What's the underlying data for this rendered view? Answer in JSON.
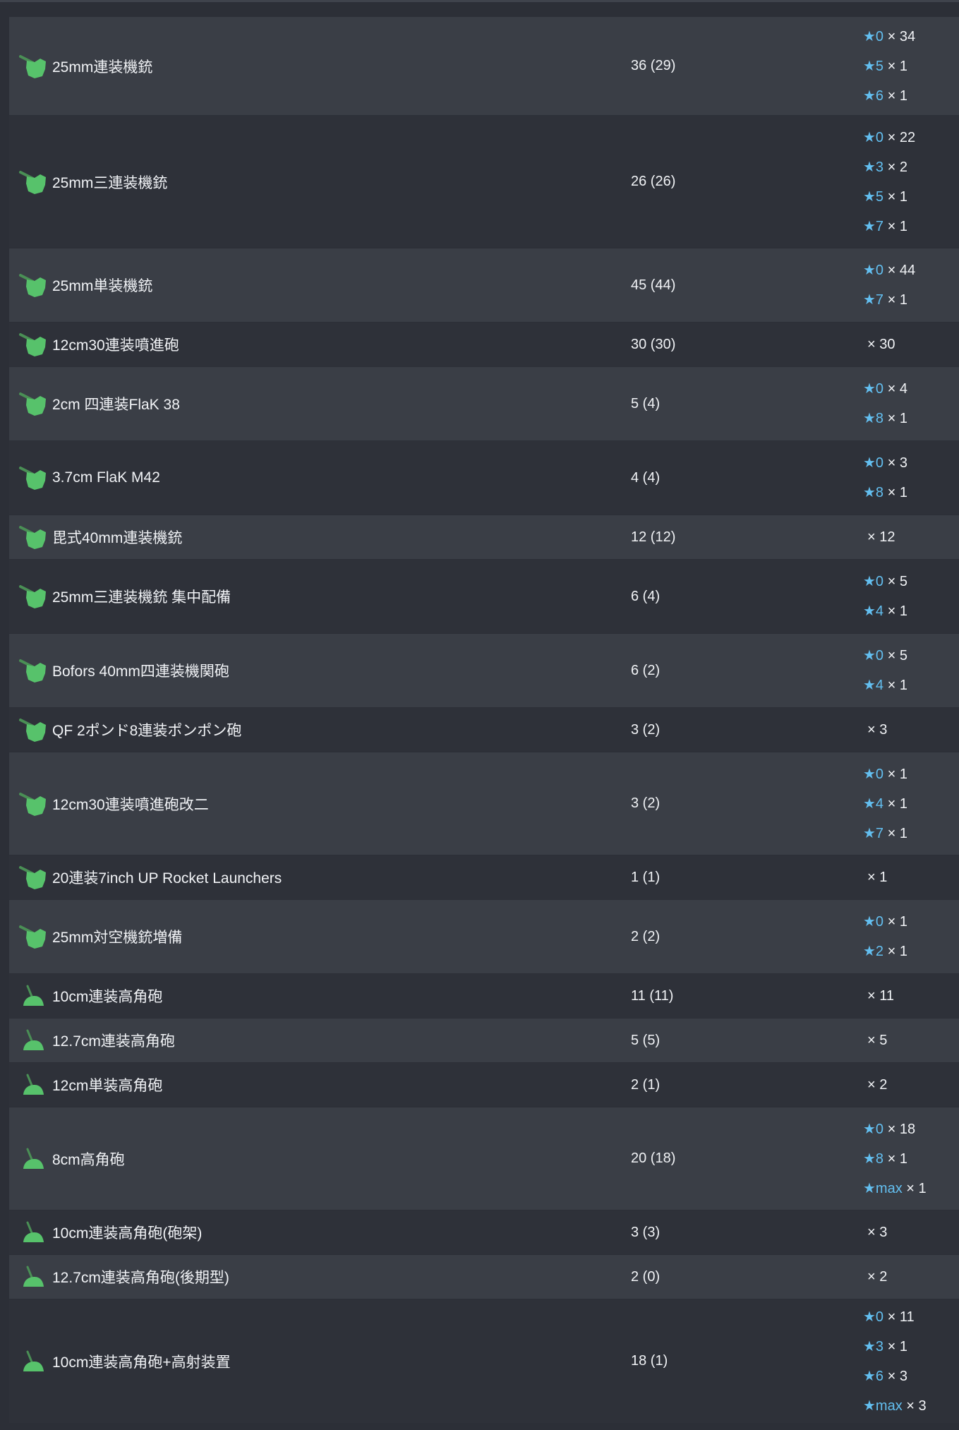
{
  "colors": {
    "background": "#2c2f37",
    "row_odd": "#3a3e46",
    "row_even": "#2e3139",
    "text": "#f1f3f6",
    "star": "#63bff0",
    "icon_green": "#57c26b",
    "icon_barrel": "#4a8f55"
  },
  "equipment": [
    {
      "name": "25mm連装機銃",
      "count": "36 (29)",
      "icon": "aa-machine-gun-icon",
      "improvements": [
        {
          "star": "★0",
          "qty": "× 34"
        },
        {
          "star": "★5",
          "qty": "× 1"
        },
        {
          "star": "★6",
          "qty": "× 1"
        }
      ]
    },
    {
      "name": "25mm三連装機銃",
      "count": "26 (26)",
      "icon": "aa-machine-gun-icon",
      "improvements": [
        {
          "star": "★0",
          "qty": "× 22"
        },
        {
          "star": "★3",
          "qty": "× 2"
        },
        {
          "star": "★5",
          "qty": "× 1"
        },
        {
          "star": "★7",
          "qty": "× 1"
        }
      ]
    },
    {
      "name": "25mm単装機銃",
      "count": "45 (44)",
      "icon": "aa-machine-gun-icon",
      "improvements": [
        {
          "star": "★0",
          "qty": "× 44"
        },
        {
          "star": "★7",
          "qty": "× 1"
        }
      ]
    },
    {
      "name": "12cm30連装噴進砲",
      "count": "30 (30)",
      "icon": "aa-machine-gun-icon",
      "improvements": [
        {
          "star": "",
          "qty": "× 30"
        }
      ]
    },
    {
      "name": "2cm 四連装FlaK 38",
      "count": "5 (4)",
      "icon": "aa-machine-gun-icon",
      "improvements": [
        {
          "star": "★0",
          "qty": "× 4"
        },
        {
          "star": "★8",
          "qty": "× 1"
        }
      ]
    },
    {
      "name": "3.7cm FlaK M42",
      "count": "4 (4)",
      "icon": "aa-machine-gun-icon",
      "improvements": [
        {
          "star": "★0",
          "qty": "× 3"
        },
        {
          "star": "★8",
          "qty": "× 1"
        }
      ]
    },
    {
      "name": "毘式40mm連装機銃",
      "count": "12 (12)",
      "icon": "aa-machine-gun-icon",
      "improvements": [
        {
          "star": "",
          "qty": "× 12"
        }
      ]
    },
    {
      "name": "25mm三連装機銃 集中配備",
      "count": "6 (4)",
      "icon": "aa-machine-gun-icon",
      "improvements": [
        {
          "star": "★0",
          "qty": "× 5"
        },
        {
          "star": "★4",
          "qty": "× 1"
        }
      ]
    },
    {
      "name": "Bofors 40mm四連装機関砲",
      "count": "6 (2)",
      "icon": "aa-machine-gun-icon",
      "improvements": [
        {
          "star": "★0",
          "qty": "× 5"
        },
        {
          "star": "★4",
          "qty": "× 1"
        }
      ]
    },
    {
      "name": "QF 2ポンド8連装ポンポン砲",
      "count": "3 (2)",
      "icon": "aa-machine-gun-icon",
      "improvements": [
        {
          "star": "",
          "qty": "× 3"
        }
      ]
    },
    {
      "name": "12cm30連装噴進砲改二",
      "count": "3 (2)",
      "icon": "aa-machine-gun-icon",
      "improvements": [
        {
          "star": "★0",
          "qty": "× 1"
        },
        {
          "star": "★4",
          "qty": "× 1"
        },
        {
          "star": "★7",
          "qty": "× 1"
        }
      ]
    },
    {
      "name": "20連装7inch UP Rocket Launchers",
      "count": "1 (1)",
      "icon": "aa-machine-gun-icon",
      "improvements": [
        {
          "star": "",
          "qty": "× 1"
        }
      ]
    },
    {
      "name": "25mm対空機銃増備",
      "count": "2 (2)",
      "icon": "aa-machine-gun-icon",
      "improvements": [
        {
          "star": "★0",
          "qty": "× 1"
        },
        {
          "star": "★2",
          "qty": "× 1"
        }
      ]
    },
    {
      "name": "10cm連装高角砲",
      "count": "11 (11)",
      "icon": "high-angle-gun-icon",
      "improvements": [
        {
          "star": "",
          "qty": "× 11"
        }
      ]
    },
    {
      "name": "12.7cm連装高角砲",
      "count": "5 (5)",
      "icon": "high-angle-gun-icon",
      "improvements": [
        {
          "star": "",
          "qty": "× 5"
        }
      ]
    },
    {
      "name": "12cm単装高角砲",
      "count": "2 (1)",
      "icon": "high-angle-gun-icon",
      "improvements": [
        {
          "star": "",
          "qty": "× 2"
        }
      ]
    },
    {
      "name": "8cm高角砲",
      "count": "20 (18)",
      "icon": "high-angle-gun-icon",
      "improvements": [
        {
          "star": "★0",
          "qty": "× 18"
        },
        {
          "star": "★8",
          "qty": "× 1"
        },
        {
          "star": "★max",
          "qty": "× 1"
        }
      ]
    },
    {
      "name": "10cm連装高角砲(砲架)",
      "count": "3 (3)",
      "icon": "high-angle-gun-icon",
      "improvements": [
        {
          "star": "",
          "qty": "× 3"
        }
      ]
    },
    {
      "name": "12.7cm連装高角砲(後期型)",
      "count": "2 (0)",
      "icon": "high-angle-gun-icon",
      "improvements": [
        {
          "star": "",
          "qty": "× 2"
        }
      ]
    },
    {
      "name": "10cm連装高角砲+高射装置",
      "count": "18 (1)",
      "icon": "high-angle-gun-icon",
      "improvements": [
        {
          "star": "★0",
          "qty": "× 11"
        },
        {
          "star": "★3",
          "qty": "× 1"
        },
        {
          "star": "★6",
          "qty": "× 3"
        },
        {
          "star": "★max",
          "qty": "× 3"
        }
      ]
    }
  ]
}
